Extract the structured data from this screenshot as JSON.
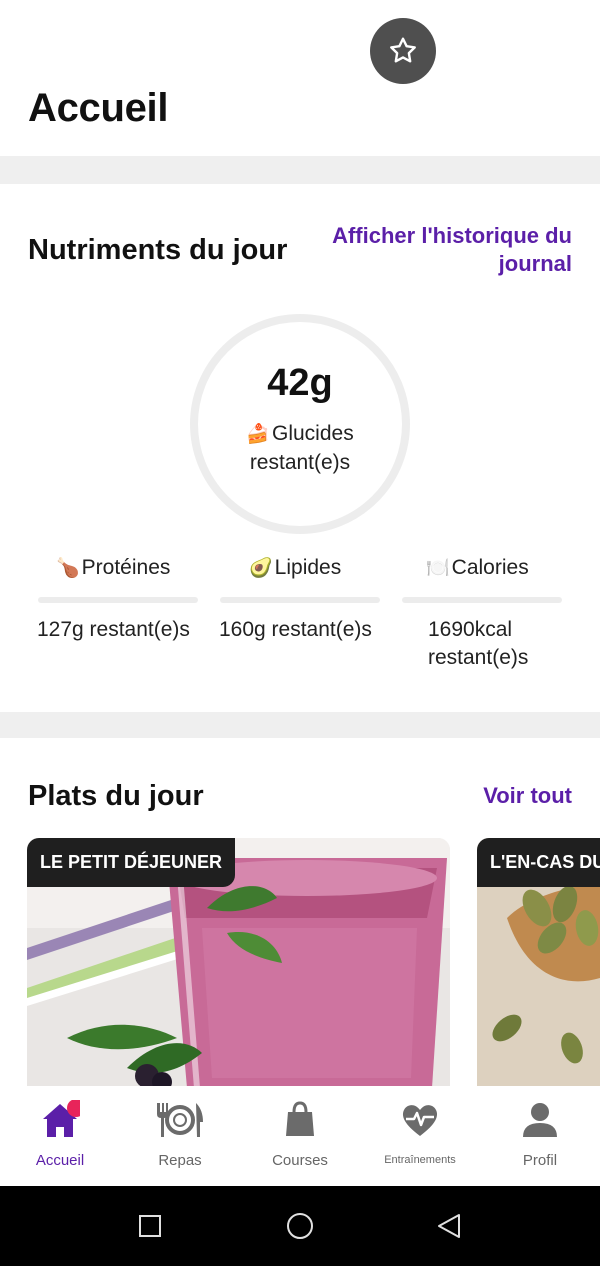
{
  "header": {
    "title": "Accueil"
  },
  "nutrients": {
    "title": "Nutriments du jour",
    "history_link_line1": "Afficher l'historique du",
    "history_link_line2": "journal",
    "ring": {
      "value": "42g",
      "emoji": "🍰",
      "label_line1": "Glucides",
      "label_line2": "restant(e)s"
    },
    "macros": [
      {
        "emoji": "🍗",
        "name": "Protéines",
        "value": "127g restant(e)s",
        "progress": 0
      },
      {
        "emoji": "🥑",
        "name": "Lipides",
        "value": "160g restant(e)s",
        "progress": 0
      },
      {
        "emoji": "🍽️",
        "name": "Calories",
        "value_line1": "1690kcal",
        "value_line2": "restant(e)s",
        "progress": 0
      }
    ]
  },
  "dishes": {
    "title": "Plats du jour",
    "see_all": "Voir tout",
    "cards": [
      {
        "badge": "LE PETIT DÉJEUNER"
      },
      {
        "badge": "L'EN-CAS DU"
      }
    ]
  },
  "nav": {
    "items": [
      {
        "label": "Accueil",
        "icon": "home-icon",
        "active": true
      },
      {
        "label": "Repas",
        "icon": "meals-icon"
      },
      {
        "label": "Courses",
        "icon": "shopping-bag-icon"
      },
      {
        "label": "Entraînements",
        "icon": "heart-pulse-icon"
      },
      {
        "label": "Profil",
        "icon": "profile-icon"
      }
    ]
  },
  "colors": {
    "accent": "#5b1fa8",
    "badge_dot": "#e8245a",
    "icon_gray": "#6b6b6b"
  }
}
